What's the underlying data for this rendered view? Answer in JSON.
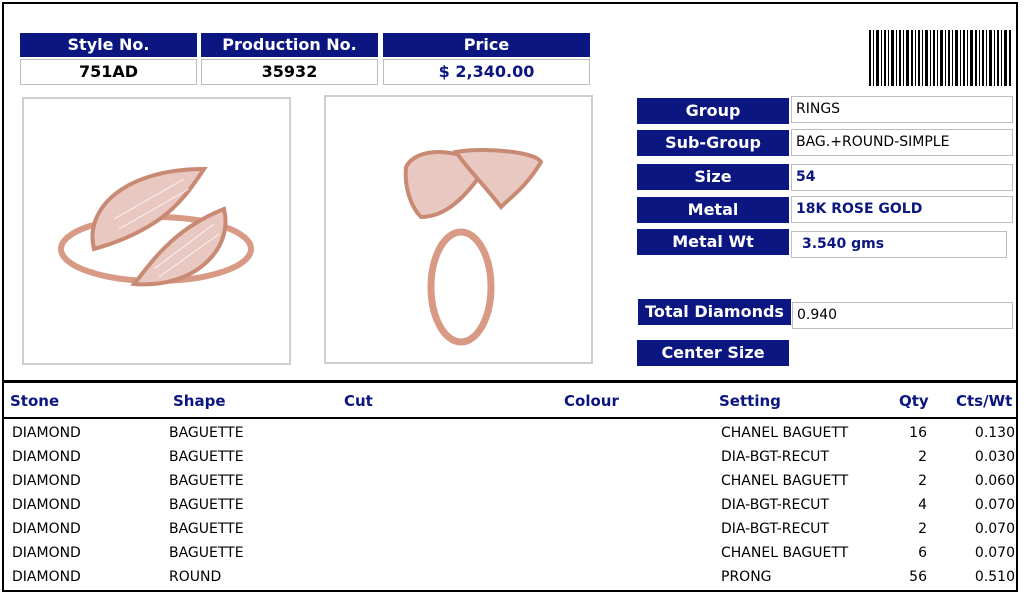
{
  "colors": {
    "header_bg": "#0b1680",
    "header_text": "#ffffff",
    "accent_text": "#0b1680"
  },
  "header": {
    "style_label": "Style No.",
    "style_value": "751AD",
    "production_label": "Production No.",
    "production_value": "35932",
    "price_label": "Price",
    "price_value": "$ 2,340.00"
  },
  "details": {
    "group_label": "Group",
    "group_value": "RINGS",
    "subgroup_label": "Sub-Group",
    "subgroup_value": "BAG.+ROUND-SIMPLE",
    "size_label": "Size",
    "size_value": "54",
    "metal_label": "Metal",
    "metal_value": "18K ROSE GOLD",
    "metal_wt_label": "Metal Wt",
    "metal_wt_value": "3.540 gms",
    "total_diamonds_label": "Total Diamonds",
    "total_diamonds_value": "0.940",
    "center_size_label": "Center Size"
  },
  "table": {
    "headers": [
      "Stone",
      "Shape",
      "Cut",
      "Colour",
      "Setting",
      "Qty",
      "Cts/Wt"
    ],
    "rows": [
      {
        "stone": "DIAMOND",
        "shape": "BAGUETTE",
        "setting": "CHANEL BAGUETT",
        "qty": "16",
        "cts": "0.130"
      },
      {
        "stone": "DIAMOND",
        "shape": "BAGUETTE",
        "setting": "DIA-BGT-RECUT",
        "qty": "2",
        "cts": "0.030"
      },
      {
        "stone": "DIAMOND",
        "shape": "BAGUETTE",
        "setting": "CHANEL BAGUETT",
        "qty": "2",
        "cts": "0.060"
      },
      {
        "stone": "DIAMOND",
        "shape": "BAGUETTE",
        "setting": "DIA-BGT-RECUT",
        "qty": "4",
        "cts": "0.070"
      },
      {
        "stone": "DIAMOND",
        "shape": "BAGUETTE",
        "setting": "DIA-BGT-RECUT",
        "qty": "2",
        "cts": "0.070"
      },
      {
        "stone": "DIAMOND",
        "shape": "BAGUETTE",
        "setting": "CHANEL BAGUETT",
        "qty": "6",
        "cts": "0.070"
      },
      {
        "stone": "DIAMOND",
        "shape": "ROUND",
        "setting": "PRONG",
        "qty": "56",
        "cts": "0.510"
      }
    ]
  }
}
